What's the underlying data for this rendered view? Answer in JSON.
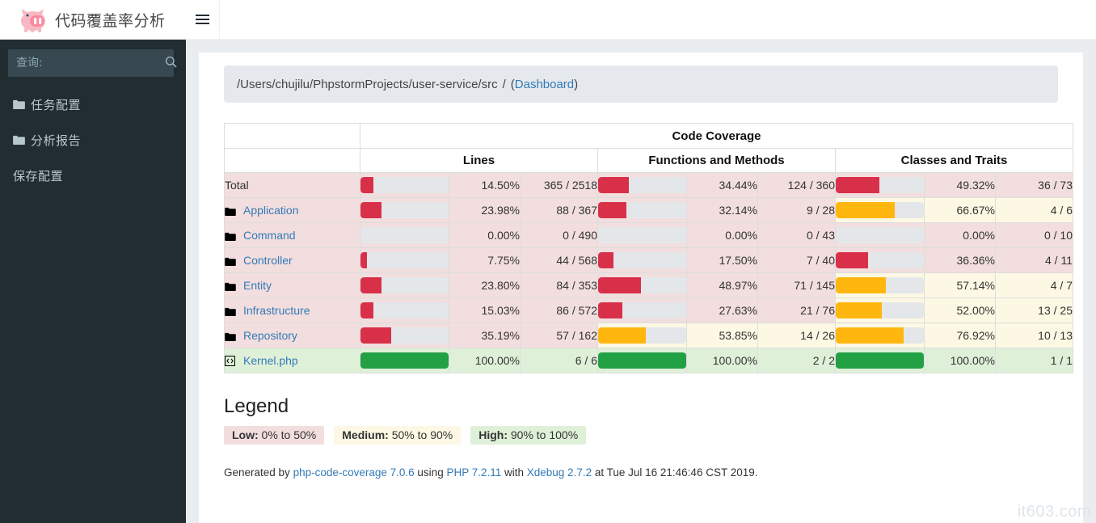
{
  "brand": {
    "title": "代码覆盖率分析",
    "logo_icon": "pig-logo-icon"
  },
  "topbar": {
    "menu_toggle_icon": "hamburger-icon"
  },
  "sidebar": {
    "search": {
      "placeholder": "查询:",
      "value": "",
      "icon": "search-icon"
    },
    "items": [
      {
        "label": "任务配置",
        "icon": "folder-icon",
        "has_icon": true
      },
      {
        "label": "分析报告",
        "icon": "folder-icon",
        "has_icon": true
      },
      {
        "label": "保存配置",
        "icon": "",
        "has_icon": false
      }
    ]
  },
  "breadcrumb": {
    "path": "/Users/chujilu/PhpstormProjects/user-service/src",
    "separator": "/",
    "open_paren": "(",
    "dashboard_link": "Dashboard",
    "close_paren": ")"
  },
  "table": {
    "group_header": "Code Coverage",
    "columns": [
      "Lines",
      "Functions and Methods",
      "Classes and Traits"
    ],
    "rows": [
      {
        "name": "Total",
        "icon": "",
        "is_link": false,
        "row_level": "low",
        "lines": {
          "percent": "14.50%",
          "pct": 14.5,
          "fraction": "365 / 2518",
          "level": "low"
        },
        "functions": {
          "percent": "34.44%",
          "pct": 34.44,
          "fraction": "124 / 360",
          "level": "low"
        },
        "classes": {
          "percent": "49.32%",
          "pct": 49.32,
          "fraction": "36 / 73",
          "level": "low"
        }
      },
      {
        "name": "Application",
        "icon": "folder-icon",
        "is_link": true,
        "row_level": "low",
        "lines": {
          "percent": "23.98%",
          "pct": 23.98,
          "fraction": "88 / 367",
          "level": "low"
        },
        "functions": {
          "percent": "32.14%",
          "pct": 32.14,
          "fraction": "9 / 28",
          "level": "low"
        },
        "classes": {
          "percent": "66.67%",
          "pct": 66.67,
          "fraction": "4 / 6",
          "level": "med"
        }
      },
      {
        "name": "Command",
        "icon": "folder-icon",
        "is_link": true,
        "row_level": "low",
        "lines": {
          "percent": "0.00%",
          "pct": 0,
          "fraction": "0 / 490",
          "level": "low"
        },
        "functions": {
          "percent": "0.00%",
          "pct": 0,
          "fraction": "0 / 43",
          "level": "low"
        },
        "classes": {
          "percent": "0.00%",
          "pct": 0,
          "fraction": "0 / 10",
          "level": "low"
        }
      },
      {
        "name": "Controller",
        "icon": "folder-icon",
        "is_link": true,
        "row_level": "low",
        "lines": {
          "percent": "7.75%",
          "pct": 7.75,
          "fraction": "44 / 568",
          "level": "low"
        },
        "functions": {
          "percent": "17.50%",
          "pct": 17.5,
          "fraction": "7 / 40",
          "level": "low"
        },
        "classes": {
          "percent": "36.36%",
          "pct": 36.36,
          "fraction": "4 / 11",
          "level": "low"
        }
      },
      {
        "name": "Entity",
        "icon": "folder-icon",
        "is_link": true,
        "row_level": "low",
        "lines": {
          "percent": "23.80%",
          "pct": 23.8,
          "fraction": "84 / 353",
          "level": "low"
        },
        "functions": {
          "percent": "48.97%",
          "pct": 48.97,
          "fraction": "71 / 145",
          "level": "low"
        },
        "classes": {
          "percent": "57.14%",
          "pct": 57.14,
          "fraction": "4 / 7",
          "level": "med"
        }
      },
      {
        "name": "Infrastructure",
        "icon": "folder-icon",
        "is_link": true,
        "row_level": "low",
        "lines": {
          "percent": "15.03%",
          "pct": 15.03,
          "fraction": "86 / 572",
          "level": "low"
        },
        "functions": {
          "percent": "27.63%",
          "pct": 27.63,
          "fraction": "21 / 76",
          "level": "low"
        },
        "classes": {
          "percent": "52.00%",
          "pct": 52.0,
          "fraction": "13 / 25",
          "level": "med"
        }
      },
      {
        "name": "Repository",
        "icon": "folder-icon",
        "is_link": true,
        "row_level": "low",
        "lines": {
          "percent": "35.19%",
          "pct": 35.19,
          "fraction": "57 / 162",
          "level": "low"
        },
        "functions": {
          "percent": "53.85%",
          "pct": 53.85,
          "fraction": "14 / 26",
          "level": "med"
        },
        "classes": {
          "percent": "76.92%",
          "pct": 76.92,
          "fraction": "10 / 13",
          "level": "med"
        }
      },
      {
        "name": "Kernel.php",
        "icon": "code-file-icon",
        "is_link": true,
        "row_level": "high",
        "lines": {
          "percent": "100.00%",
          "pct": 100,
          "fraction": "6 / 6",
          "level": "high"
        },
        "functions": {
          "percent": "100.00%",
          "pct": 100,
          "fraction": "2 / 2",
          "level": "high"
        },
        "classes": {
          "percent": "100.00%",
          "pct": 100,
          "fraction": "1 / 1",
          "level": "high"
        }
      }
    ]
  },
  "legend": {
    "title": "Legend",
    "items": [
      {
        "label": "Low:",
        "range": "0% to 50%",
        "level": "low"
      },
      {
        "label": "Medium:",
        "range": "50% to 90%",
        "level": "med"
      },
      {
        "label": "High:",
        "range": "90% to 100%",
        "level": "high"
      }
    ]
  },
  "footer": {
    "prefix": "Generated by ",
    "tool": "php-code-coverage 7.0.6",
    "mid1": " using ",
    "php": "PHP 7.2.11",
    "mid2": " with ",
    "xdebug": "Xdebug 2.7.2",
    "suffix": " at Tue Jul 16 21:46:46 CST 2019."
  },
  "watermark": "it603.com",
  "colors": {
    "sidebar_bg": "#222d32",
    "low_bar": "#d9304a",
    "med_bar": "#ffb710",
    "high_bar": "#22a044",
    "low_bg": "#f2dede",
    "med_bg": "#fcf8e3",
    "high_bg": "#dff0d8",
    "link": "#337ab7"
  }
}
